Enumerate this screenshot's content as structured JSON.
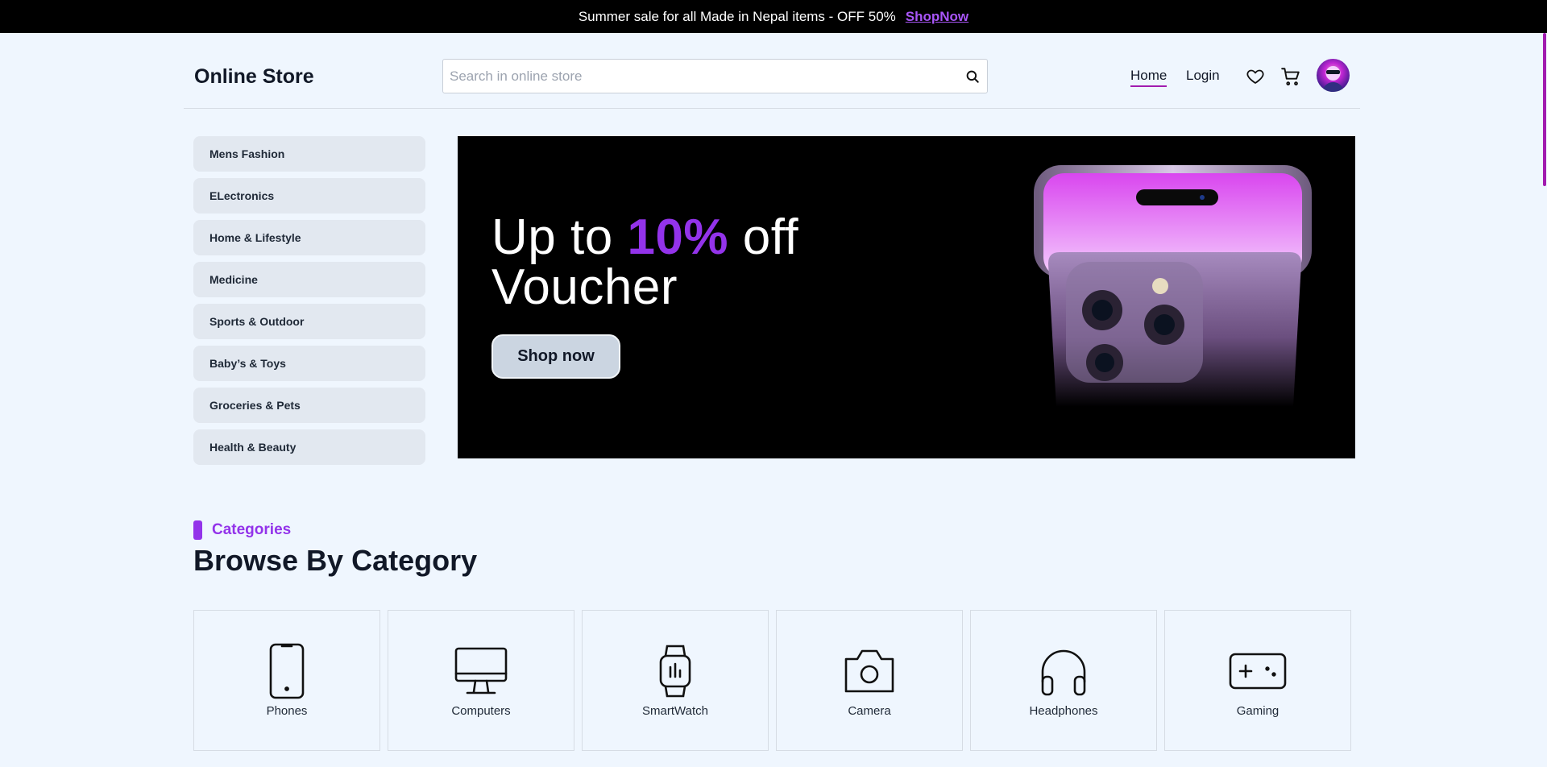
{
  "topbar": {
    "message": "Summer sale for all Made in Nepal items - OFF 50%",
    "link": "ShopNow"
  },
  "header": {
    "logo": "Online Store",
    "search_placeholder": "Search in online store",
    "nav_home": "Home",
    "nav_login": "Login",
    "icons": [
      "search-icon",
      "heart-icon",
      "cart-icon",
      "avatar"
    ]
  },
  "sidebar": {
    "items": [
      {
        "label": "Mens Fashion"
      },
      {
        "label": "ELectronics"
      },
      {
        "label": "Home & Lifestyle"
      },
      {
        "label": "Medicine"
      },
      {
        "label": "Sports & Outdoor"
      },
      {
        "label": "Baby’s & Toys"
      },
      {
        "label": "Groceries & Pets"
      },
      {
        "label": "Health & Beauty"
      }
    ]
  },
  "hero": {
    "title_prefix": "Up to",
    "title_accent": "10%",
    "title_suffix": "off",
    "title_line2": "Voucher",
    "button": "Shop now",
    "accent_color": "#9333ea"
  },
  "categories": {
    "tag": "Categories",
    "heading": "Browse By Category",
    "items": [
      {
        "label": "Phones",
        "icon": "phone-icon"
      },
      {
        "label": "Computers",
        "icon": "monitor-icon"
      },
      {
        "label": "SmartWatch",
        "icon": "smartwatch-icon"
      },
      {
        "label": "Camera",
        "icon": "camera-icon"
      },
      {
        "label": "Headphones",
        "icon": "headphones-icon"
      },
      {
        "label": "Gaming",
        "icon": "gamepad-icon"
      }
    ]
  }
}
